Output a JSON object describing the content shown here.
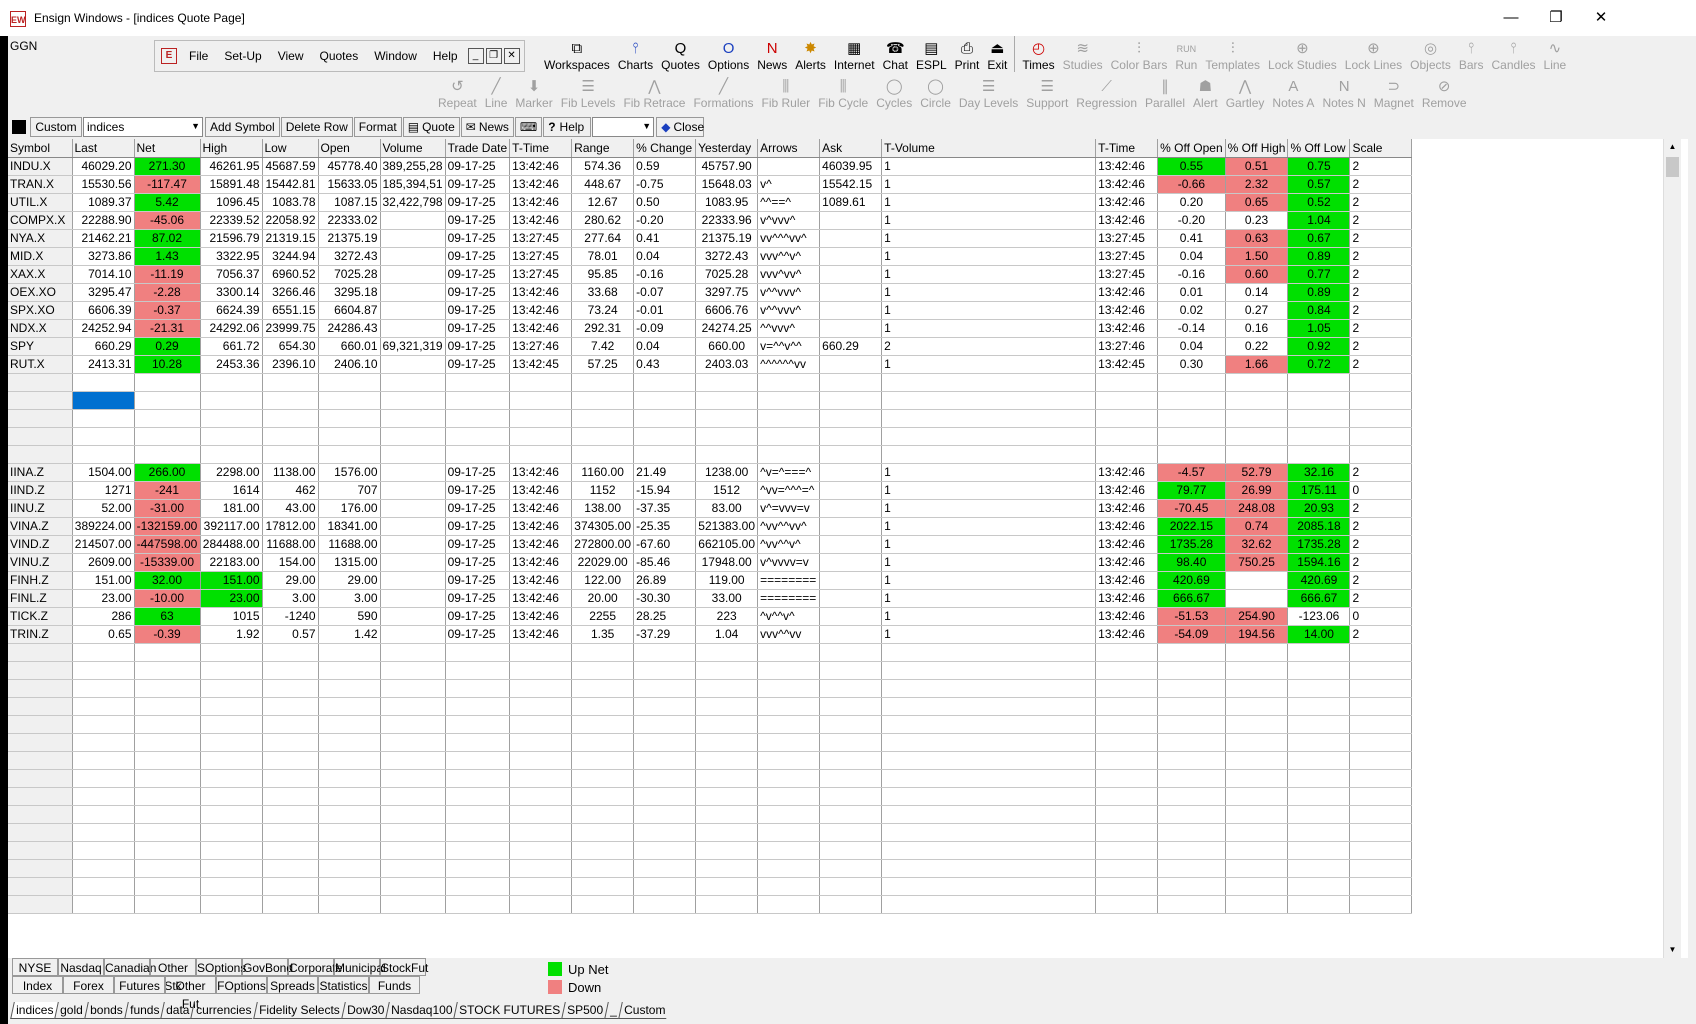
{
  "window": {
    "title": "Ensign Windows - [indices Quote Page]",
    "app_icon": "EW",
    "minimize": "—",
    "restore": "❐",
    "close": "✕"
  },
  "ggn": "GGN",
  "menu": [
    "File",
    "Set-Up",
    "View",
    "Quotes",
    "Window",
    "Help"
  ],
  "toolbar1": [
    {
      "label": "Workspaces",
      "icon": "⧉",
      "dis": false
    },
    {
      "label": "Charts",
      "icon": "⫯",
      "dis": false
    },
    {
      "label": "Quotes",
      "icon": "Q",
      "dis": false
    },
    {
      "label": "Options",
      "icon": "O",
      "dis": false
    },
    {
      "label": "News",
      "icon": "N",
      "dis": false
    },
    {
      "label": "Alerts",
      "icon": "✸",
      "dis": false
    },
    {
      "label": "Internet",
      "icon": "▦",
      "dis": false
    },
    {
      "label": "Chat",
      "icon": "☎",
      "dis": false
    },
    {
      "label": "ESPL",
      "icon": "▤",
      "dis": false
    },
    {
      "label": "Print",
      "icon": "⎙",
      "dis": false
    },
    {
      "label": "Exit",
      "icon": "⏏",
      "dis": false
    },
    {
      "label": "Times",
      "icon": "◴",
      "dis": false
    },
    {
      "label": "Studies",
      "icon": "≋",
      "dis": true
    },
    {
      "label": "Color Bars",
      "icon": "⫶",
      "dis": true
    },
    {
      "label": "Run",
      "icon": "RUN",
      "dis": true
    },
    {
      "label": "Templates",
      "icon": "⫶",
      "dis": true
    },
    {
      "label": "Lock Studies",
      "icon": "⊕",
      "dis": true
    },
    {
      "label": "Lock Lines",
      "icon": "⊕",
      "dis": true
    },
    {
      "label": "Objects",
      "icon": "◎",
      "dis": true
    },
    {
      "label": "Bars",
      "icon": "⫯",
      "dis": true
    },
    {
      "label": "Candles",
      "icon": "⫯",
      "dis": true
    },
    {
      "label": "Line",
      "icon": "∿",
      "dis": true
    }
  ],
  "toolbar2": [
    "Repeat",
    "Line",
    "Marker",
    "Fib Levels",
    "Fib Retrace",
    "Formations",
    "Fib Ruler",
    "Fib Cycle",
    "Cycles",
    "Circle",
    "Day Levels",
    "Support",
    "Regression",
    "Parallel",
    "Alert",
    "Gartley",
    "Notes A",
    "Notes N",
    "Magnet",
    "Remove"
  ],
  "toolbar2_icons": [
    "↺",
    "╱",
    "⬇",
    "☰",
    "⋀",
    "╱",
    "⫼",
    "⫼",
    "◯",
    "◯",
    "☰",
    "☰",
    "⟋",
    "∥",
    "☗",
    "⋀",
    "A",
    "N",
    "⊃",
    "⊘"
  ],
  "quotebar": {
    "custom": "Custom",
    "page_select": "indices",
    "add_symbol": "Add Symbol",
    "delete_row": "Delete Row",
    "format": "Format",
    "quote": "Quote",
    "news": "News",
    "help": "Help",
    "close": "Close",
    "help_select": ""
  },
  "columns": [
    "Symbol",
    "Last",
    "Net",
    "High",
    "Low",
    "Open",
    "Volume",
    "Trade Date",
    "T-Time",
    "Range",
    "% Change",
    "Yesterday",
    "Arrows",
    "Ask",
    "T-Volume",
    "T-Time",
    "% Off Open",
    "% Off High",
    "% Off Low",
    "Scale"
  ],
  "rows": [
    {
      "v": [
        "INDU.X",
        "46029.20",
        "271.30",
        "46261.95",
        "45687.59",
        "45778.40",
        "389,255,28",
        "09-17-25",
        "13:42:46",
        "574.36",
        "0.59",
        "45757.90",
        "",
        "46039.95",
        "1",
        "13:42:46",
        "0.55",
        "0.51",
        "0.75",
        "2"
      ],
      "col": {
        "2": "up",
        "16": "up",
        "17": "dn",
        "18": "up"
      }
    },
    {
      "v": [
        "TRAN.X",
        "15530.56",
        "-117.47",
        "15891.48",
        "15442.81",
        "15633.05",
        "185,394,51",
        "09-17-25",
        "13:42:46",
        "448.67",
        "-0.75",
        "15648.03",
        "v^",
        "15542.15",
        "1",
        "13:42:46",
        "-0.66",
        "2.32",
        "0.57",
        "2"
      ],
      "col": {
        "2": "dn",
        "16": "dn",
        "17": "dn",
        "18": "up"
      }
    },
    {
      "v": [
        "UTIL.X",
        "1089.37",
        "5.42",
        "1096.45",
        "1083.78",
        "1087.15",
        "32,422,798",
        "09-17-25",
        "13:42:46",
        "12.67",
        "0.50",
        "1083.95",
        "^^==^",
        "1089.61",
        "1",
        "13:42:46",
        "0.20",
        "0.65",
        "0.52",
        "2"
      ],
      "col": {
        "2": "up",
        "17": "dn",
        "18": "up"
      }
    },
    {
      "v": [
        "COMPX.X",
        "22288.90",
        "-45.06",
        "22339.52",
        "22058.92",
        "22333.02",
        "",
        "09-17-25",
        "13:42:46",
        "280.62",
        "-0.20",
        "22333.96",
        "v^vvv^",
        "",
        "1",
        "13:42:46",
        "-0.20",
        "0.23",
        "1.04",
        "2"
      ],
      "col": {
        "2": "dn",
        "18": "up"
      }
    },
    {
      "v": [
        "NYA.X",
        "21462.21",
        "87.02",
        "21596.79",
        "21319.15",
        "21375.19",
        "",
        "09-17-25",
        "13:27:45",
        "277.64",
        "0.41",
        "21375.19",
        "vv^^^vv^",
        "",
        "1",
        "13:27:45",
        "0.41",
        "0.63",
        "0.67",
        "2"
      ],
      "col": {
        "2": "up",
        "17": "dn",
        "18": "up"
      }
    },
    {
      "v": [
        "MID.X",
        "3273.86",
        "1.43",
        "3322.95",
        "3244.94",
        "3272.43",
        "",
        "09-17-25",
        "13:27:45",
        "78.01",
        "0.04",
        "3272.43",
        "vvv^^v^",
        "",
        "1",
        "13:27:45",
        "0.04",
        "1.50",
        "0.89",
        "2"
      ],
      "col": {
        "2": "up",
        "17": "dn",
        "18": "up"
      }
    },
    {
      "v": [
        "XAX.X",
        "7014.10",
        "-11.19",
        "7056.37",
        "6960.52",
        "7025.28",
        "",
        "09-17-25",
        "13:27:45",
        "95.85",
        "-0.16",
        "7025.28",
        "vvv^vv^",
        "",
        "1",
        "13:27:45",
        "-0.16",
        "0.60",
        "0.77",
        "2"
      ],
      "col": {
        "2": "dn",
        "17": "dn",
        "18": "up"
      }
    },
    {
      "v": [
        "OEX.XO",
        "3295.47",
        "-2.28",
        "3300.14",
        "3266.46",
        "3295.18",
        "",
        "09-17-25",
        "13:42:46",
        "33.68",
        "-0.07",
        "3297.75",
        "v^^vvv^",
        "",
        "1",
        "13:42:46",
        "0.01",
        "0.14",
        "0.89",
        "2"
      ],
      "col": {
        "2": "dn",
        "18": "up"
      }
    },
    {
      "v": [
        "SPX.XO",
        "6606.39",
        "-0.37",
        "6624.39",
        "6551.15",
        "6604.87",
        "",
        "09-17-25",
        "13:42:46",
        "73.24",
        "-0.01",
        "6606.76",
        "v^^vvv^",
        "",
        "1",
        "13:42:46",
        "0.02",
        "0.27",
        "0.84",
        "2"
      ],
      "col": {
        "2": "dn",
        "18": "up"
      }
    },
    {
      "v": [
        "NDX.X",
        "24252.94",
        "-21.31",
        "24292.06",
        "23999.75",
        "24286.43",
        "",
        "09-17-25",
        "13:42:46",
        "292.31",
        "-0.09",
        "24274.25",
        "^^vvv^",
        "",
        "1",
        "13:42:46",
        "-0.14",
        "0.16",
        "1.05",
        "2"
      ],
      "col": {
        "2": "dn",
        "18": "up"
      }
    },
    {
      "v": [
        "SPY",
        "660.29",
        "0.29",
        "661.72",
        "654.30",
        "660.01",
        "69,321,319",
        "09-17-25",
        "13:27:46",
        "7.42",
        "0.04",
        "660.00",
        "v=^^v^^",
        "660.29",
        "2",
        "13:27:46",
        "0.04",
        "0.22",
        "0.92",
        "2"
      ],
      "col": {
        "2": "up",
        "18": "up"
      }
    },
    {
      "v": [
        "RUT.X",
        "2413.31",
        "10.28",
        "2453.36",
        "2396.10",
        "2406.10",
        "",
        "09-17-25",
        "13:42:45",
        "57.25",
        "0.43",
        "2403.03",
        "^^^^^^vv",
        "",
        "1",
        "13:42:45",
        "0.30",
        "1.66",
        "0.72",
        "2"
      ],
      "col": {
        "2": "up",
        "17": "dn",
        "18": "up"
      }
    },
    {
      "v": [],
      "col": {}
    },
    {
      "v": [],
      "col": {
        "1": "sel"
      }
    },
    {
      "v": [],
      "col": {}
    },
    {
      "v": [],
      "col": {}
    },
    {
      "v": [],
      "col": {}
    },
    {
      "v": [
        "IINA.Z",
        "1504.00",
        "266.00",
        "2298.00",
        "1138.00",
        "1576.00",
        "",
        "09-17-25",
        "13:42:46",
        "1160.00",
        "21.49",
        "1238.00",
        "^v=^===^",
        "",
        "1",
        "13:42:46",
        "-4.57",
        "52.79",
        "32.16",
        "2"
      ],
      "col": {
        "2": "up",
        "16": "dn",
        "17": "dn",
        "18": "up"
      }
    },
    {
      "v": [
        "IIND.Z",
        "1271",
        "-241",
        "1614",
        "462",
        "707",
        "",
        "09-17-25",
        "13:42:46",
        "1152",
        "-15.94",
        "1512",
        "^vv=^^^=^",
        "",
        "1",
        "13:42:46",
        "79.77",
        "26.99",
        "175.11",
        "0"
      ],
      "col": {
        "2": "dn",
        "16": "up",
        "17": "dn",
        "18": "up"
      }
    },
    {
      "v": [
        "IINU.Z",
        "52.00",
        "-31.00",
        "181.00",
        "43.00",
        "176.00",
        "",
        "09-17-25",
        "13:42:46",
        "138.00",
        "-37.35",
        "83.00",
        "v^=vvv=v",
        "",
        "1",
        "13:42:46",
        "-70.45",
        "248.08",
        "20.93",
        "2"
      ],
      "col": {
        "2": "dn",
        "16": "dn",
        "17": "dn",
        "18": "up"
      }
    },
    {
      "v": [
        "VINA.Z",
        "389224.00",
        "-132159.00",
        "392117.00",
        "17812.00",
        "18341.00",
        "",
        "09-17-25",
        "13:42:46",
        "374305.00",
        "-25.35",
        "521383.00",
        "^vv^^vv^",
        "",
        "1",
        "13:42:46",
        "2022.15",
        "0.74",
        "2085.18",
        "2"
      ],
      "col": {
        "2": "dn",
        "16": "up",
        "17": "dn",
        "18": "up"
      }
    },
    {
      "v": [
        "VIND.Z",
        "214507.00",
        "-447598.00",
        "284488.00",
        "11688.00",
        "11688.00",
        "",
        "09-17-25",
        "13:42:46",
        "272800.00",
        "-67.60",
        "662105.00",
        "^vv^^v^",
        "",
        "1",
        "13:42:46",
        "1735.28",
        "32.62",
        "1735.28",
        "2"
      ],
      "col": {
        "2": "dn",
        "16": "up",
        "17": "dn",
        "18": "up"
      }
    },
    {
      "v": [
        "VINU.Z",
        "2609.00",
        "-15339.00",
        "22183.00",
        "154.00",
        "1315.00",
        "",
        "09-17-25",
        "13:42:46",
        "22029.00",
        "-85.46",
        "17948.00",
        "v^vvvv=v",
        "",
        "1",
        "13:42:46",
        "98.40",
        "750.25",
        "1594.16",
        "2"
      ],
      "col": {
        "2": "dn",
        "16": "up",
        "17": "dn",
        "18": "up"
      }
    },
    {
      "v": [
        "FINH.Z",
        "151.00",
        "32.00",
        "151.00",
        "29.00",
        "29.00",
        "",
        "09-17-25",
        "13:42:46",
        "122.00",
        "26.89",
        "119.00",
        "========",
        "",
        "1",
        "13:42:46",
        "420.69",
        "",
        "420.69",
        "2"
      ],
      "col": {
        "2": "up",
        "3": "up",
        "16": "up",
        "18": "up"
      }
    },
    {
      "v": [
        "FINL.Z",
        "23.00",
        "-10.00",
        "23.00",
        "3.00",
        "3.00",
        "",
        "09-17-25",
        "13:42:46",
        "20.00",
        "-30.30",
        "33.00",
        "========",
        "",
        "1",
        "13:42:46",
        "666.67",
        "",
        "666.67",
        "2"
      ],
      "col": {
        "2": "dn",
        "3": "up",
        "16": "up",
        "18": "up"
      }
    },
    {
      "v": [
        "TICK.Z",
        "286",
        "63",
        "1015",
        "-1240",
        "590",
        "",
        "09-17-25",
        "13:42:46",
        "2255",
        "28.25",
        "223",
        "^v^^v^",
        "",
        "1",
        "13:42:46",
        "-51.53",
        "254.90",
        "-123.06",
        "0"
      ],
      "col": {
        "2": "up",
        "16": "dn",
        "17": "dn"
      }
    },
    {
      "v": [
        "TRIN.Z",
        "0.65",
        "-0.39",
        "1.92",
        "0.57",
        "1.42",
        "",
        "09-17-25",
        "13:42:46",
        "1.35",
        "-37.29",
        "1.04",
        "vvv^^vv",
        "",
        "1",
        "13:42:46",
        "-54.09",
        "194.56",
        "14.00",
        "2"
      ],
      "col": {
        "2": "dn",
        "16": "dn",
        "17": "dn",
        "18": "up"
      }
    }
  ],
  "empty_rows_after": 15,
  "exchange_buttons_row1": [
    "NYSE",
    "Nasdaq",
    "Canadian",
    "Other Stk",
    "SOptions",
    "GovBond",
    "Corporate",
    "Municipal",
    "StockFut"
  ],
  "exchange_buttons_row2": [
    "Index",
    "Forex",
    "Futures",
    "Other Fut",
    "FOptions",
    "Spreads",
    "Statistics",
    "Funds"
  ],
  "legend": {
    "up": "Up Net",
    "down": "Down",
    "up_color": "#00e000",
    "down_color": "#f08080"
  },
  "page_tabs": [
    "indices",
    "gold",
    "bonds",
    "funds",
    "data",
    "currencies",
    "Fidelity Selects",
    "Dow30",
    "Nasdaq100",
    "STOCK FUTURES",
    "SP500",
    "_",
    "Custom"
  ]
}
